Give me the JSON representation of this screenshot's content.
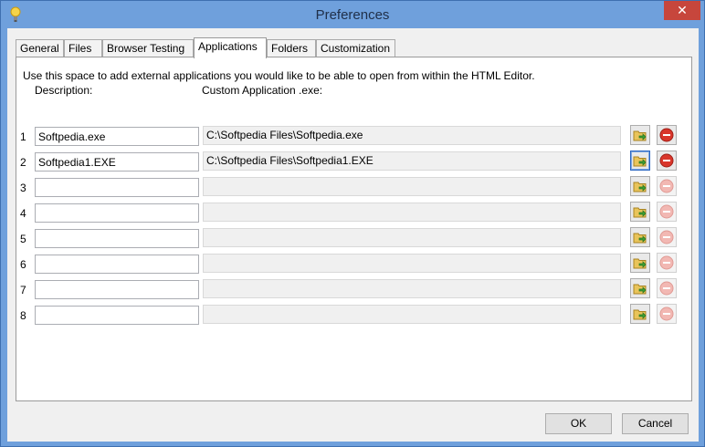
{
  "window": {
    "title": "Preferences",
    "close_label": "✕"
  },
  "tabs": [
    {
      "label": "General"
    },
    {
      "label": "Files"
    },
    {
      "label": "Browser Testing"
    },
    {
      "label": "Applications"
    },
    {
      "label": "Folders"
    },
    {
      "label": "Customization"
    }
  ],
  "active_tab": "Applications",
  "applications": {
    "help_text": "Use this space to add external applications you would like to be able to open from within the HTML Editor.",
    "col_description": "Description:",
    "col_exe": "Custom Application .exe:",
    "rows": [
      {
        "num": "1",
        "description": "Softpedia.exe",
        "exe": "C:\\Softpedia Files\\Softpedia.exe"
      },
      {
        "num": "2",
        "description": "Softpedia1.EXE",
        "exe": "C:\\Softpedia Files\\Softpedia1.EXE"
      },
      {
        "num": "3",
        "description": "",
        "exe": ""
      },
      {
        "num": "4",
        "description": "",
        "exe": ""
      },
      {
        "num": "5",
        "description": "",
        "exe": ""
      },
      {
        "num": "6",
        "description": "",
        "exe": ""
      },
      {
        "num": "7",
        "description": "",
        "exe": ""
      },
      {
        "num": "8",
        "description": "",
        "exe": ""
      }
    ]
  },
  "buttons": {
    "ok": "OK",
    "cancel": "Cancel"
  },
  "icons": {
    "app": "lightbulb-icon",
    "browse": "open-folder-arrow-icon",
    "remove": "remove-circle-icon"
  },
  "colors": {
    "title_bar": "#6fa0dc",
    "close": "#c7463c",
    "remove_red": "#d9362b"
  }
}
